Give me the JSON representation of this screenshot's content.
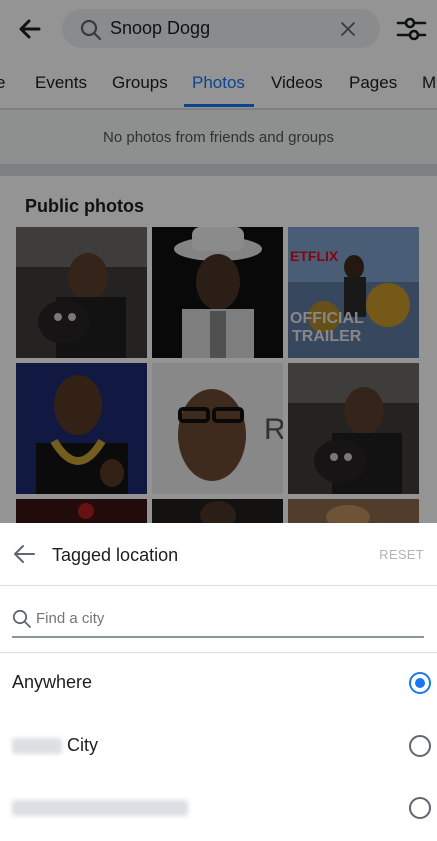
{
  "search": {
    "query": "Snoop Dogg"
  },
  "tabs": [
    {
      "label": "e"
    },
    {
      "label": "Events"
    },
    {
      "label": "Groups"
    },
    {
      "label": "Photos"
    },
    {
      "label": "Videos"
    },
    {
      "label": "Pages"
    },
    {
      "label": "M"
    }
  ],
  "active_tab": "Photos",
  "empty_message": "No photos from friends and groups",
  "public_photos": {
    "title": "Public photos",
    "photo_texts": {
      "netflix": "ETFLIX",
      "official": "OFFICIAL",
      "trailer": "TRAILER",
      "r_letter": "R"
    }
  },
  "sheet": {
    "title": "Tagged location",
    "reset_label": "RESET",
    "search_placeholder": "Find a city",
    "options": [
      {
        "label": "Anywhere",
        "selected": true
      },
      {
        "label": "City",
        "selected": false
      },
      {
        "label": "",
        "selected": false
      }
    ]
  },
  "colors": {
    "accent": "#1877f2",
    "text": "#1c1e21",
    "muted": "#b0b3b8"
  },
  "icons": [
    "back-arrow-icon",
    "search-icon",
    "clear-icon",
    "filter-icon",
    "radio-icon"
  ]
}
